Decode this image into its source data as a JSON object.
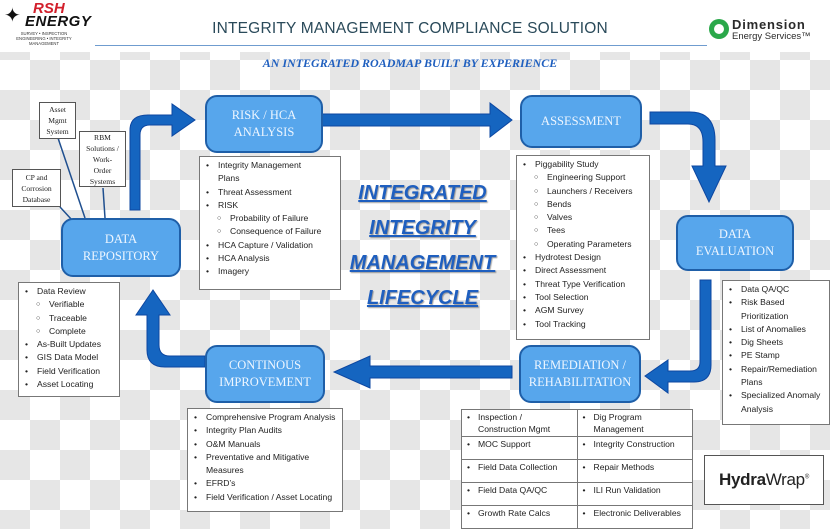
{
  "header": {
    "title": "INTEGRITY MANAGEMENT COMPLIANCE SOLUTION",
    "subtitle": "AN INTEGRATED ROADMAP BUILT BY EXPERIENCE"
  },
  "logos": {
    "rsh": {
      "line1": "RSH",
      "line2": "ENERGY",
      "tagline1": "SURVEY • INSPECTION",
      "tagline2": "ENGINEERING • INTEGRITY MANAGEMENT",
      "accent": "#d21f2b"
    },
    "dimension": {
      "name": "Dimension",
      "sub": "Energy Services™",
      "accent": "#2aa84a"
    },
    "hydrawrap": {
      "bold": "Hydra",
      "rest": "Wrap",
      "mark": "®"
    }
  },
  "center_title": {
    "lines": [
      "INTEGRATED",
      "INTEGRITY",
      "MANAGEMENT",
      "LIFECYCLE"
    ]
  },
  "colors": {
    "stage_fill": "#57a6ec",
    "stage_border": "#1f5fa8",
    "arrow": "#1565c0",
    "title_blue": "#1f5fbf"
  },
  "stages": {
    "risk": {
      "line1": "RISK / HCA",
      "line2": "ANALYSIS"
    },
    "assessment": {
      "line1": "ASSESSMENT"
    },
    "evaluation": {
      "line1": "DATA",
      "line2": "EVALUATION"
    },
    "remediation": {
      "line1": "REMEDIATION /",
      "line2": "REHABILITATION"
    },
    "improvement": {
      "line1": "CONTINOUS",
      "line2": "IMPROVEMENT"
    },
    "repository": {
      "line1": "DATA",
      "line2": "REPOSITORY"
    }
  },
  "repository_links": {
    "asset_mgmt": [
      "Asset",
      "Mgmt",
      "System"
    ],
    "rbm": [
      "RBM",
      "Solutions /",
      "Work-",
      "Order",
      "Systems"
    ],
    "cp": [
      "CP and",
      "Corrosion",
      "Database"
    ]
  },
  "lists": {
    "risk": [
      {
        "text": "Integrity Management",
        "level": 1
      },
      {
        "text": "Plans",
        "level": 0
      },
      {
        "text": "Threat Assessment",
        "level": 1
      },
      {
        "text": "RISK",
        "level": 1
      },
      {
        "text": "Probability of Failure",
        "level": 2
      },
      {
        "text": "Consequence of Failure",
        "level": 2
      },
      {
        "text": "HCA Capture / Validation",
        "level": 1
      },
      {
        "text": "HCA Analysis",
        "level": 1
      },
      {
        "text": "Imagery",
        "level": 1
      }
    ],
    "assessment": [
      {
        "text": "Piggability Study",
        "level": 1
      },
      {
        "text": "Engineering Support",
        "level": 2
      },
      {
        "text": "Launchers / Receivers",
        "level": 2
      },
      {
        "text": "Bends",
        "level": 2
      },
      {
        "text": "Valves",
        "level": 2
      },
      {
        "text": "Tees",
        "level": 2
      },
      {
        "text": "Operating Parameters",
        "level": 2
      },
      {
        "text": "Hydrotest Design",
        "level": 1
      },
      {
        "text": "Direct Assessment",
        "level": 1
      },
      {
        "text": "Threat Type Verification",
        "level": 1
      },
      {
        "text": "Tool Selection",
        "level": 1
      },
      {
        "text": "AGM Survey",
        "level": 1
      },
      {
        "text": "Tool Tracking",
        "level": 1
      }
    ],
    "evaluation": [
      {
        "text": "Data QA/QC",
        "level": 1
      },
      {
        "text": "Risk Based",
        "level": 1
      },
      {
        "text": "Prioritization",
        "level": 0
      },
      {
        "text": "List of Anomalies",
        "level": 1
      },
      {
        "text": "Dig Sheets",
        "level": 1
      },
      {
        "text": "PE Stamp",
        "level": 1
      },
      {
        "text": "Repair/Remediation",
        "level": 1
      },
      {
        "text": "Plans",
        "level": 0
      },
      {
        "text": "Specialized Anomaly",
        "level": 1
      },
      {
        "text": "Analysis",
        "level": 0
      }
    ],
    "repository": [
      {
        "text": "Data Review",
        "level": 1
      },
      {
        "text": "Verifiable",
        "level": 2
      },
      {
        "text": "Traceable",
        "level": 2
      },
      {
        "text": "Complete",
        "level": 2
      },
      {
        "text": "As-Built Updates",
        "level": 1
      },
      {
        "text": "GIS Data Model",
        "level": 1
      },
      {
        "text": "Field Verification",
        "level": 1
      },
      {
        "text": "Asset Locating",
        "level": 1
      }
    ],
    "improvement": [
      {
        "text": "Comprehensive Program Analysis",
        "level": 1
      },
      {
        "text": "Integrity Plan Audits",
        "level": 1
      },
      {
        "text": "O&M Manuals",
        "level": 1
      },
      {
        "text": "Preventative and Mitigative",
        "level": 1
      },
      {
        "text": "Measures",
        "level": 0
      },
      {
        "text": "EFRD’s",
        "level": 1
      },
      {
        "text": "Field Verification / Asset Locating",
        "level": 1
      }
    ]
  },
  "remediation_table": {
    "rows": [
      [
        "Inspection / Construction Mgmt",
        "Dig Program Management"
      ],
      [
        "MOC Support",
        "Integrity Construction"
      ],
      [
        "Field Data Collection",
        "Repair Methods"
      ],
      [
        "Field Data QA/QC",
        "ILI  Run Validation"
      ],
      [
        "Growth Rate Calcs",
        "Electronic Deliverables"
      ]
    ]
  }
}
